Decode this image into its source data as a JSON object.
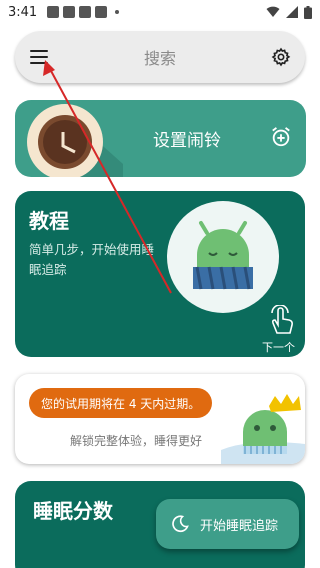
{
  "status_bar": {
    "time": "3:41"
  },
  "search": {
    "placeholder": "搜索"
  },
  "alarm_card": {
    "label": "设置闹铃"
  },
  "tutorial_card": {
    "title": "教程",
    "description": "简单几步，开始使用睡眠追踪",
    "next_label": "下一个"
  },
  "trial_card": {
    "badge_text": "您的试用期将在 4 天内过期。",
    "subtitle": "解锁完整体验，睡得更好"
  },
  "score_card": {
    "title": "睡眠分数"
  },
  "fab": {
    "label": "开始睡眠追踪"
  },
  "colors": {
    "accent_teal": "#3e9e8a",
    "dark_teal": "#0b6c5c",
    "trial_orange": "#e06a10",
    "annotation_red": "#d62828"
  }
}
